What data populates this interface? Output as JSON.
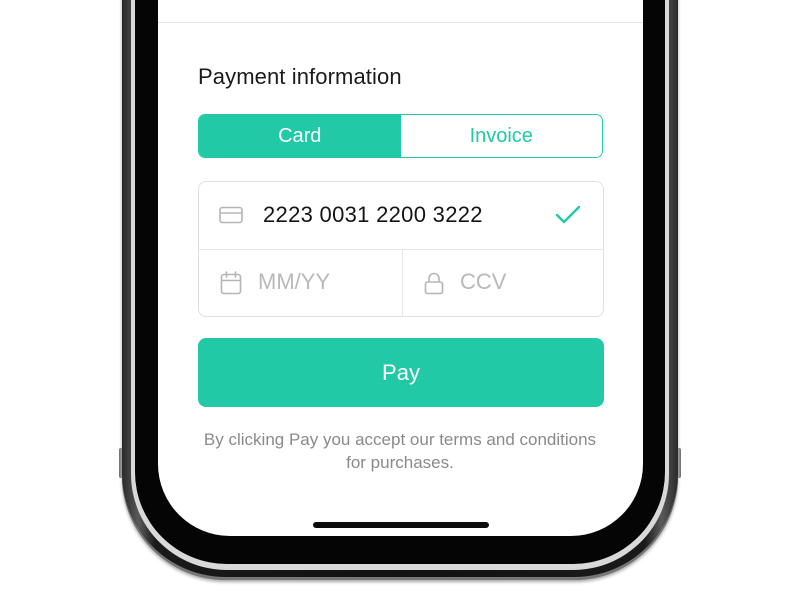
{
  "payment": {
    "title": "Payment information",
    "tabs": [
      {
        "label": "Card",
        "active": true
      },
      {
        "label": "Invoice",
        "active": false
      }
    ],
    "card_number": {
      "value": "2223 0031 2200 3222",
      "icon": "credit-card-icon",
      "valid_icon": "check-icon"
    },
    "expiry": {
      "placeholder": "MM/YY",
      "value": "",
      "icon": "calendar-icon"
    },
    "ccv": {
      "placeholder": "CCV",
      "value": "",
      "icon": "lock-icon"
    },
    "pay_button_label": "Pay",
    "terms_text": "By clicking Pay you accept our terms and conditions for purchases."
  },
  "colors": {
    "accent": "#22c9a6",
    "text": "#141414",
    "placeholder": "#b9b9b9",
    "muted": "#8a8a8a",
    "border": "#e1e1e1"
  }
}
